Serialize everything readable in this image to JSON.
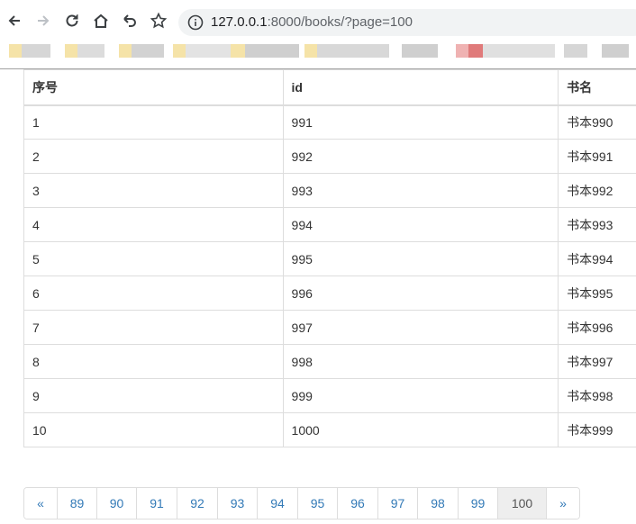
{
  "browser": {
    "url_host": "127.0.0.1",
    "url_rest": ":8000/books/?page=100",
    "icons": [
      "back-icon",
      "forward-icon",
      "reload-icon",
      "home-icon",
      "undo-icon",
      "star-icon",
      "info-icon"
    ]
  },
  "table": {
    "headers": [
      "序号",
      "id",
      "书名"
    ],
    "rows": [
      [
        "1",
        "991",
        "书本990"
      ],
      [
        "2",
        "992",
        "书本991"
      ],
      [
        "3",
        "993",
        "书本992"
      ],
      [
        "4",
        "994",
        "书本993"
      ],
      [
        "5",
        "995",
        "书本994"
      ],
      [
        "6",
        "996",
        "书本995"
      ],
      [
        "7",
        "997",
        "书本996"
      ],
      [
        "8",
        "998",
        "书本997"
      ],
      [
        "9",
        "999",
        "书本998"
      ],
      [
        "10",
        "1000",
        "书本999"
      ]
    ]
  },
  "pagination": {
    "prev": "«",
    "pages": [
      "89",
      "90",
      "91",
      "92",
      "93",
      "94",
      "95",
      "96",
      "97",
      "98",
      "99",
      "100"
    ],
    "active": "100",
    "next": "»"
  },
  "colors": {
    "link": "#337ab7",
    "active_bg": "#eeeeee",
    "border": "#dddddd"
  }
}
